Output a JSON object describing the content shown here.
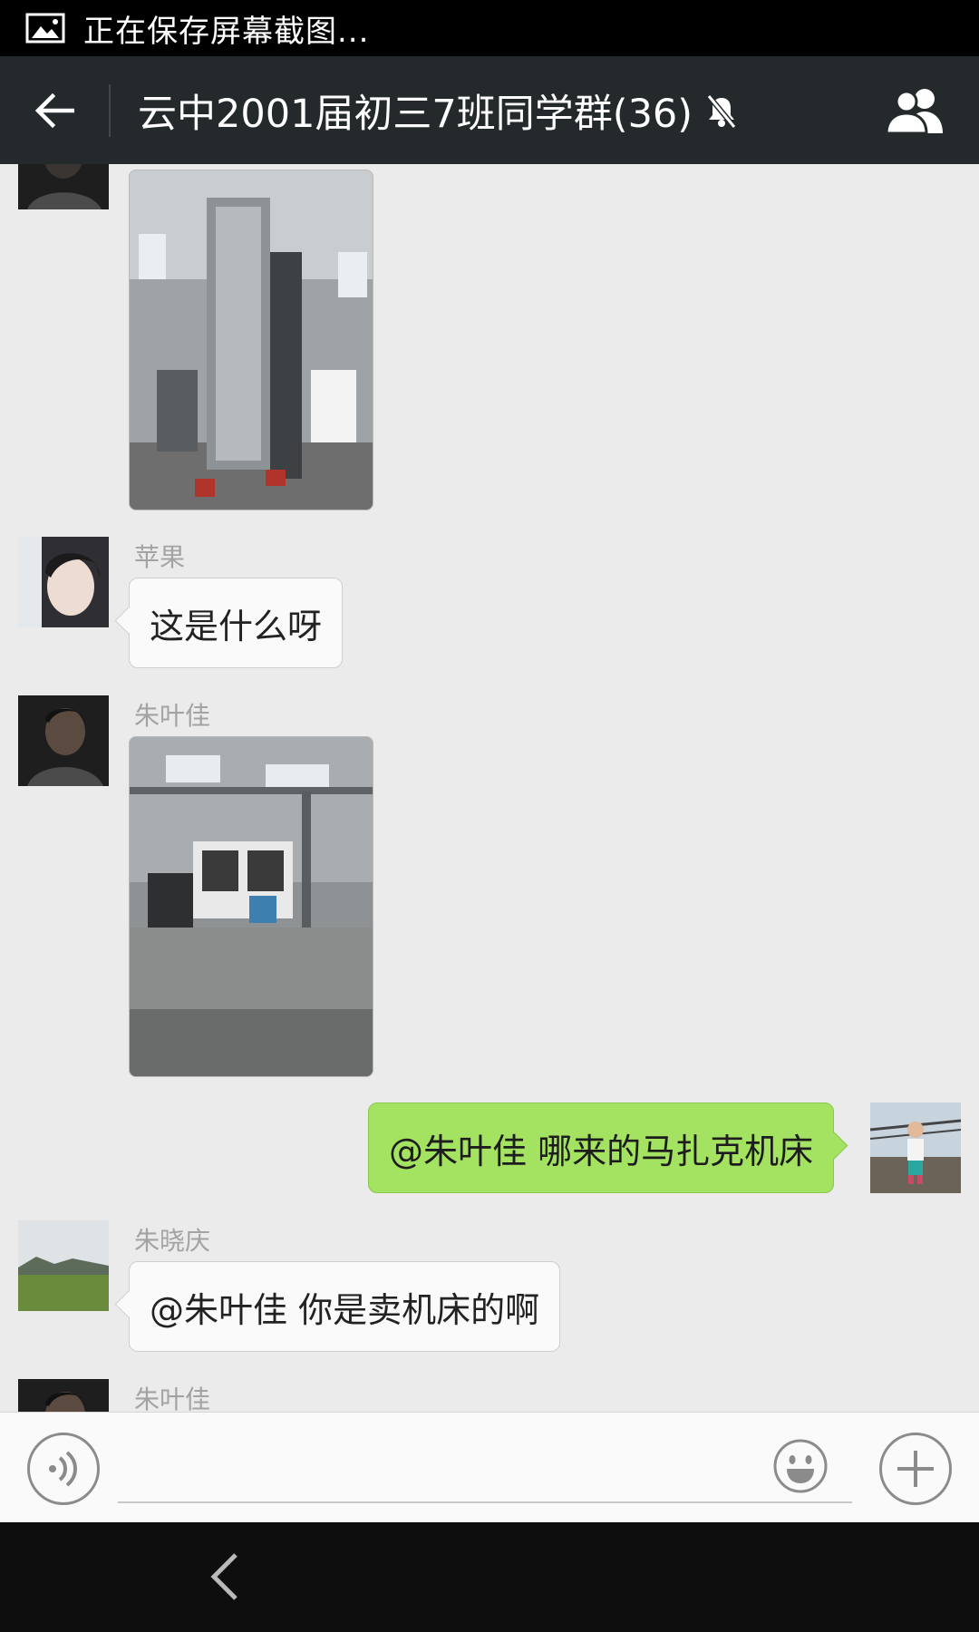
{
  "statusbar": {
    "notification_text": "正在保存屏幕截图...",
    "icon": "image-icon"
  },
  "actionbar": {
    "title": "云中2001届初三7班同学群(36)",
    "back_icon": "back-arrow-icon",
    "mute_icon": "bell-muted-icon",
    "members_icon": "group-members-icon"
  },
  "messages": [
    {
      "type": "image",
      "sender": "",
      "side": "left",
      "description": "boring-mill-machine-photo"
    },
    {
      "type": "text",
      "sender": "苹果",
      "side": "left",
      "text": "这是什么呀"
    },
    {
      "type": "image",
      "sender": "朱叶佳",
      "side": "left",
      "description": "factory-machine-photo"
    },
    {
      "type": "text",
      "sender": "",
      "side": "right",
      "text": "@朱叶佳 哪来的马扎克机床"
    },
    {
      "type": "text",
      "sender": "朱晓庆",
      "side": "left",
      "text": "@朱叶佳 你是卖机床的啊"
    },
    {
      "type": "partial",
      "sender": "朱叶佳",
      "side": "left"
    }
  ],
  "inputbar": {
    "voice_icon": "voice-icon",
    "input_value": "",
    "emoji_icon": "emoji-icon",
    "plus_icon": "plus-icon"
  },
  "colors": {
    "actionbar": "#24292c",
    "chat_bg": "#ebebeb",
    "my_bubble": "#a4e361",
    "other_bubble": "#fafafa"
  }
}
